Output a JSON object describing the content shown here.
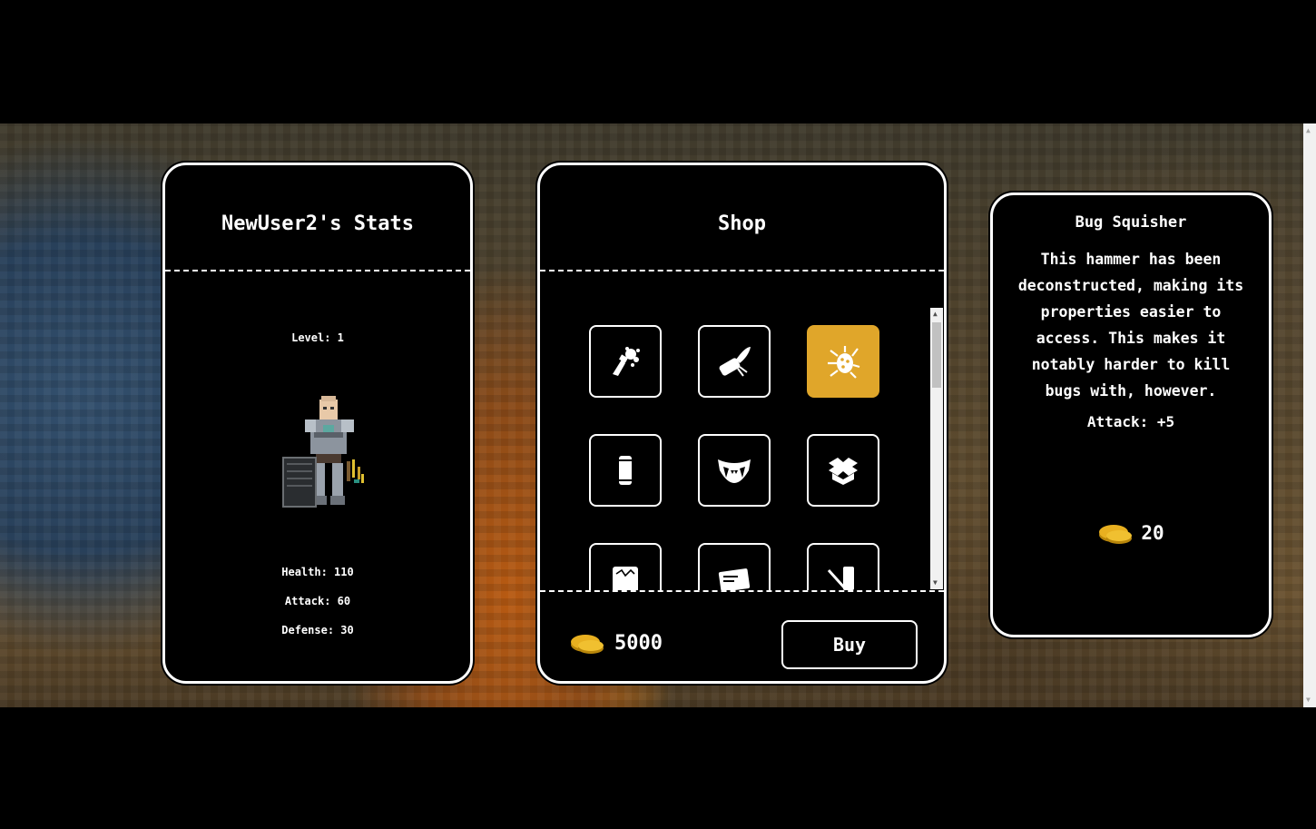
{
  "stats": {
    "title": "NewUser2's Stats",
    "level": "Level: 1",
    "health": "Health: 110",
    "attack": "Attack: 60",
    "defense": "Defense: 30"
  },
  "shop": {
    "title": "Shop",
    "items": [
      {
        "icon": "potion-splash-icon"
      },
      {
        "icon": "scroll-feather-icon"
      },
      {
        "icon": "bug-squisher-icon",
        "selected": true
      },
      {
        "icon": "can-icon"
      },
      {
        "icon": "fangs-icon"
      },
      {
        "icon": "open-box-icon"
      },
      {
        "icon": "map-icon"
      },
      {
        "icon": "certificate-icon"
      },
      {
        "icon": "scroll-sword-icon"
      }
    ],
    "wallet": "5000",
    "buy_label": "Buy"
  },
  "detail": {
    "name": "Bug Squisher",
    "description": "This hammer has been deconstructed, making its properties easier to access. This makes it notably harder to kill bugs with, however.",
    "stat": "Attack: +5",
    "price": "20"
  },
  "colors": {
    "accent_gold": "#e0a62a",
    "panel_bg": "#000000",
    "panel_border": "#ffffff"
  }
}
